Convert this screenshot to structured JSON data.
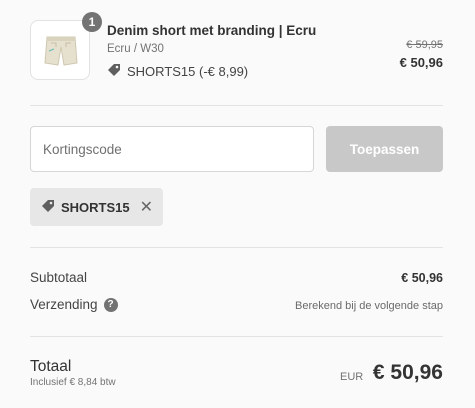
{
  "product": {
    "quantity": "1",
    "title": "Denim short met branding | Ecru",
    "variant": "Ecru / W30",
    "discount": "SHORTS15 (-€ 8,99)",
    "original_price": "€ 59,95",
    "price": "€ 50,96",
    "image_icon": "shorts-icon"
  },
  "discount_form": {
    "placeholder": "Kortingscode",
    "apply_label": "Toepassen"
  },
  "applied_code": {
    "code": "SHORTS15",
    "remove": "✕",
    "icon": "tag-icon"
  },
  "summary": {
    "subtotal_label": "Subtotaal",
    "subtotal_value": "€ 50,96",
    "shipping_label": "Verzending",
    "shipping_help": "?",
    "shipping_value": "Berekend bij de volgende stap"
  },
  "total": {
    "label": "Totaal",
    "tax_note": "Inclusief € 8,84 btw",
    "currency": "EUR",
    "amount": "€ 50,96"
  },
  "colors": {
    "accent_disabled": "#c8c8c8",
    "text": "#333333",
    "muted": "#737373"
  }
}
